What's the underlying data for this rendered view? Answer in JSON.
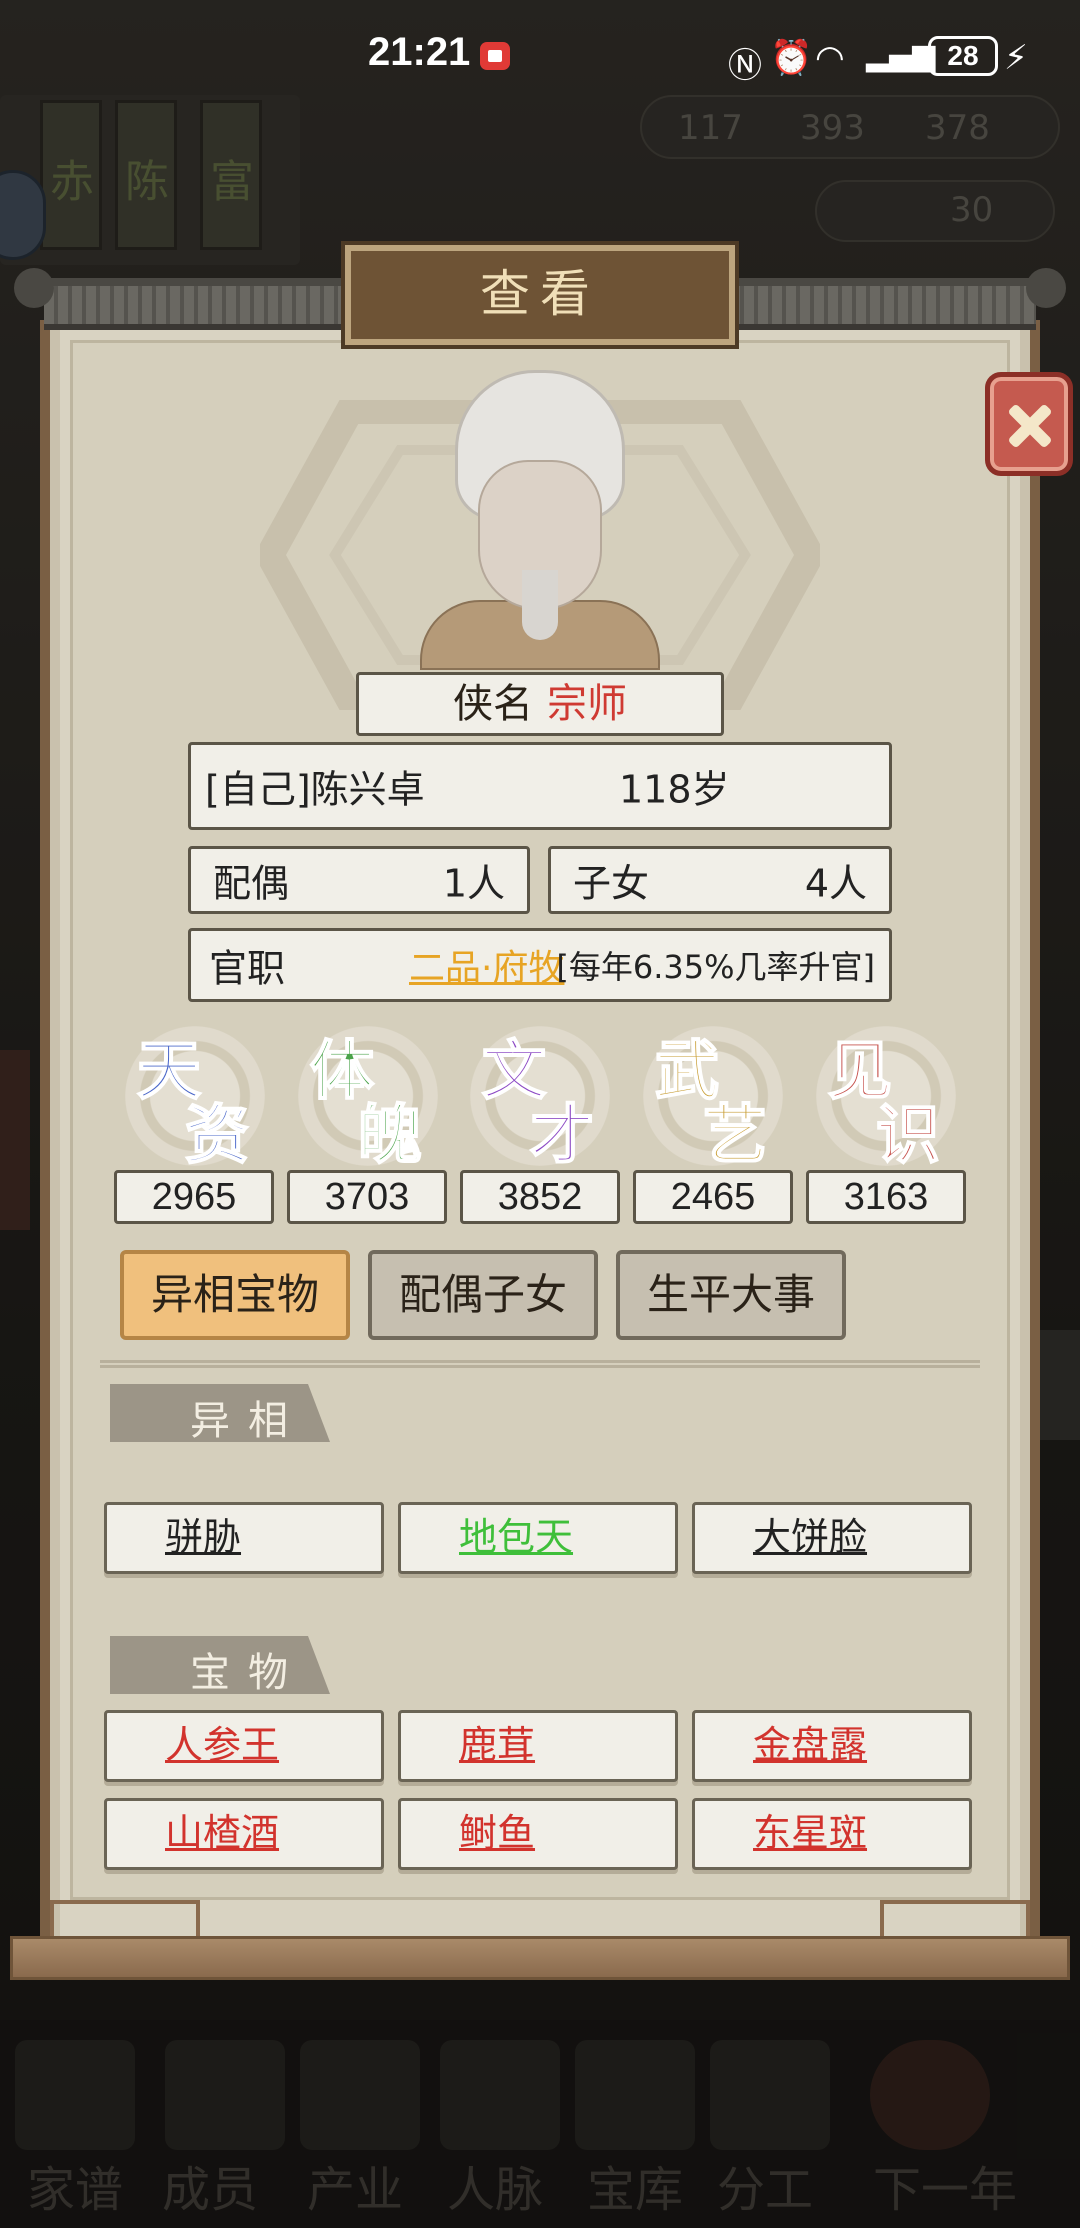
{
  "status_bar": {
    "time": "21:21",
    "battery": "28"
  },
  "background": {
    "banners": [
      "赤",
      "陈",
      "富"
    ],
    "resources": [
      "117",
      "393",
      "378"
    ],
    "gold": "30",
    "nav": [
      "家谱",
      "成员",
      "产业",
      "人脉",
      "宝库",
      "分工",
      "下一年"
    ]
  },
  "dialog": {
    "title": "查看",
    "name_label": "侠名",
    "name_title": "宗师",
    "identity": "[自己]陈兴卓",
    "age": "118岁",
    "spouse_label": "配偶",
    "spouse_count": "1人",
    "children_label": "子女",
    "children_count": "4人",
    "office_label": "官职",
    "office_value": "二品·府牧",
    "office_note": "[每年6.35%几率升官]",
    "attributes": [
      {
        "c1": "天",
        "c2": "资",
        "value": "2965",
        "color": "#4a67c9"
      },
      {
        "c1": "体",
        "c2": "魄",
        "value": "3703",
        "color": "#4aa34a"
      },
      {
        "c1": "文",
        "c2": "才",
        "value": "3852",
        "color": "#8c49c4"
      },
      {
        "c1": "武",
        "c2": "艺",
        "value": "2465",
        "color": "#c69a2d"
      },
      {
        "c1": "见",
        "c2": "识",
        "value": "3163",
        "color": "#c54f4a"
      }
    ],
    "tabs": [
      "异相宝物",
      "配偶子女",
      "生平大事"
    ],
    "traits_label": "异相",
    "traits": [
      "骈胁",
      "地包天",
      "大饼脸"
    ],
    "treasures_label": "宝物",
    "treasures": [
      "人参王",
      "鹿茸",
      "金盘露",
      "山楂酒",
      "鲥鱼",
      "东星斑"
    ]
  }
}
